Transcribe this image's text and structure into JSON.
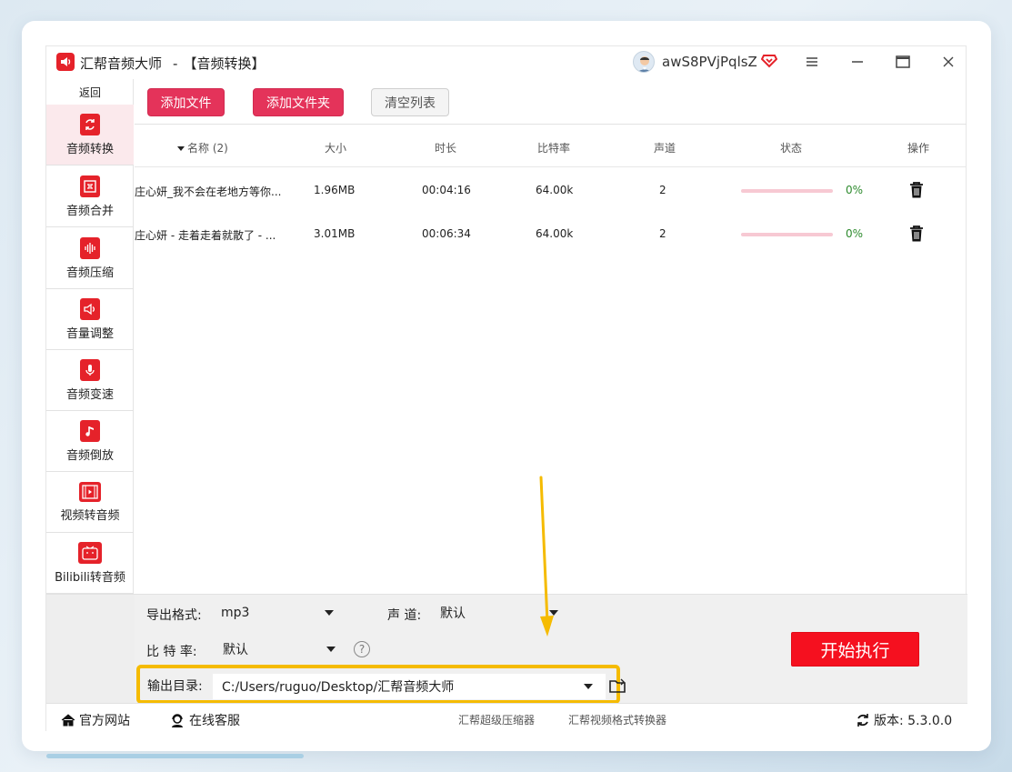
{
  "window": {
    "app_name": "汇帮音频大师",
    "separator": "-",
    "section": "【音频转换】",
    "username": "awS8PVjPqlsZ"
  },
  "sidebar": {
    "back_label": "返回",
    "items": [
      {
        "label": "音频转换",
        "icon": "convert-icon"
      },
      {
        "label": "音频合并",
        "icon": "merge-icon"
      },
      {
        "label": "音频压缩",
        "icon": "compress-icon"
      },
      {
        "label": "音量调整",
        "icon": "volume-icon"
      },
      {
        "label": "音频变速",
        "icon": "mic-icon"
      },
      {
        "label": "音频倒放",
        "icon": "music-note-icon"
      },
      {
        "label": "视频转音频",
        "icon": "film-icon"
      },
      {
        "label": "Bilibili转音频",
        "icon": "tv-icon"
      }
    ]
  },
  "toolbar": {
    "add_file": "添加文件",
    "add_folder": "添加文件夹",
    "clear_list": "清空列表"
  },
  "table": {
    "columns": {
      "name": "名称 (2)",
      "size": "大小",
      "duration": "时长",
      "bitrate": "比特率",
      "channels": "声道",
      "status": "状态",
      "action": "操作"
    },
    "rows": [
      {
        "name": "庄心妍_我不会在老地方等你...",
        "size": "1.96MB",
        "duration": "00:04:16",
        "bitrate": "64.00k",
        "channels": "2",
        "progress": "0%"
      },
      {
        "name": "庄心妍 - 走着走着就散了 - ...",
        "size": "3.01MB",
        "duration": "00:06:34",
        "bitrate": "64.00k",
        "channels": "2",
        "progress": "0%"
      }
    ]
  },
  "settings": {
    "format_label": "导出格式:",
    "format_value": "mp3",
    "channel_label": "声 道:",
    "channel_value": "默认",
    "bitrate_label": "比 特 率:",
    "bitrate_value": "默认",
    "help": "?",
    "output_label": "输出目录:",
    "output_value": "C:/Users/ruguo/Desktop/汇帮音频大师",
    "start_button": "开始执行"
  },
  "footer": {
    "website": "官方网站",
    "support": "在线客服",
    "link1": "汇帮超级压缩器",
    "link2": "汇帮视频格式转换器",
    "version": "版本: 5.3.0.0"
  },
  "colors": {
    "accent_red": "#e4335a",
    "start_red": "#f5101f",
    "highlight_yellow": "#f5bb00",
    "progress_pink": "#f7c9d3"
  }
}
